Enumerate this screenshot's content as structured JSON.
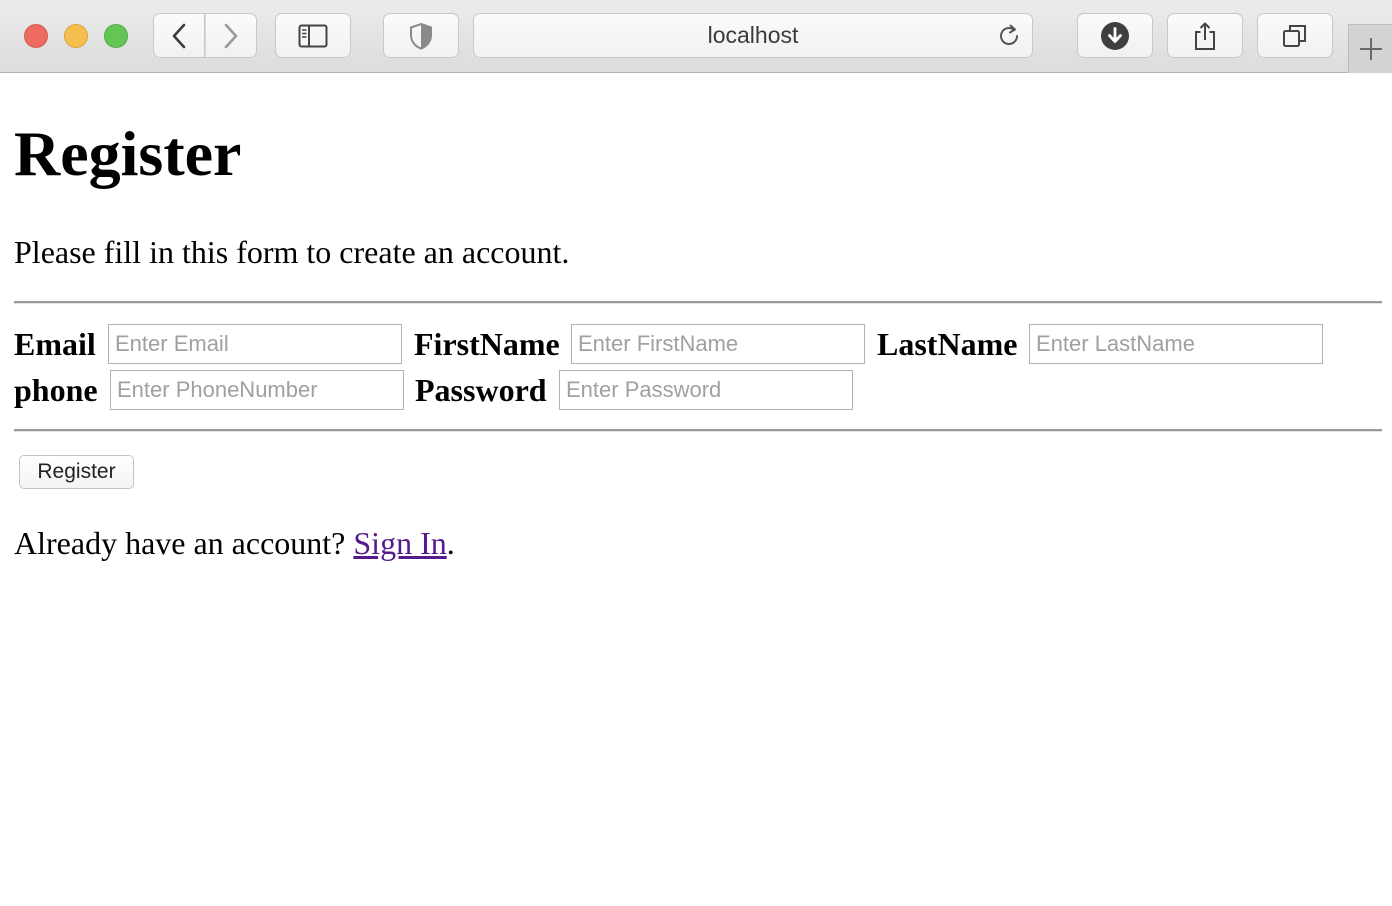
{
  "browser": {
    "address": "localhost",
    "icons": [
      "close-window",
      "minimize-window",
      "maximize-window",
      "back",
      "forward",
      "sidebar",
      "privacy-shield",
      "reload",
      "downloads",
      "share",
      "tab-overview",
      "new-tab"
    ]
  },
  "page": {
    "title": "Register",
    "intro": "Please fill in this form to create an account.",
    "form": {
      "email_label": "Email",
      "email_placeholder": "Enter Email",
      "email_value": "",
      "firstname_label": "FirstName",
      "firstname_placeholder": "Enter FirstName",
      "firstname_value": "",
      "lastname_label": "LastName",
      "lastname_placeholder": "Enter LastName",
      "lastname_value": "",
      "phone_label": "phone",
      "phone_placeholder": "Enter PhoneNumber",
      "phone_value": "",
      "password_label": "Password",
      "password_placeholder": "Enter Password",
      "password_value": ""
    },
    "register_button": "Register",
    "signin_prompt": "Already have an account?",
    "signin_link": "Sign In",
    "signin_suffix": "."
  },
  "colors": {
    "link_visited": "#551a8b",
    "close": "#ed6a5e",
    "minimize": "#f5bf4f",
    "maximize": "#62c554"
  }
}
